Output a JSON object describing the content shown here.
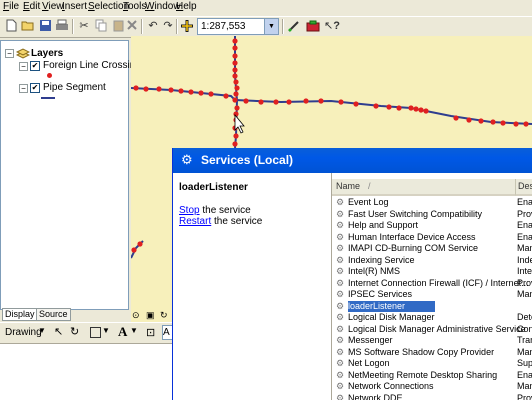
{
  "menu": [
    "File",
    "Edit",
    "View",
    "Insert",
    "Selection",
    "Tools",
    "Window",
    "Help"
  ],
  "toolbar": {
    "scale": "1:287,553",
    "help_icon": "?"
  },
  "toc": {
    "root": "Layers",
    "layer1": "Foreign Line Crossing",
    "layer2": "Pipe Segment",
    "check": "✔"
  },
  "tabs": {
    "display": "Display",
    "source": "Source"
  },
  "drawing": {
    "label": "Drawing",
    "text_tool": "A",
    "font_box": "A"
  },
  "colors": {
    "pipe_line": "#2f3d8f",
    "crossing_point": "#e02020",
    "map_background": "#f7f0bb",
    "selection": "#316ac5"
  },
  "services_window": {
    "title": "Services (Local)",
    "selected_service": "loaderListener",
    "stop_link": "Stop",
    "stop_suffix": " the service",
    "restart_link": "Restart",
    "restart_suffix": " the service",
    "columns": {
      "name": "Name",
      "sort_indicator": "/",
      "description": "Des"
    },
    "services": [
      {
        "name": "Event Log",
        "desc": "Ena"
      },
      {
        "name": "Fast User Switching Compatibility",
        "desc": "Prov"
      },
      {
        "name": "Help and Support",
        "desc": "Ena"
      },
      {
        "name": "Human Interface Device Access",
        "desc": "Ena"
      },
      {
        "name": "IMAPI CD-Burning COM Service",
        "desc": "Man"
      },
      {
        "name": "Indexing Service",
        "desc": "Inde"
      },
      {
        "name": "Intel(R) NMS",
        "desc": "Intel"
      },
      {
        "name": "Internet Connection Firewall (ICF) / Internet...",
        "desc": "Prov"
      },
      {
        "name": "IPSEC Services",
        "desc": "Man"
      },
      {
        "name": "loaderListener",
        "desc": ""
      },
      {
        "name": "Logical Disk Manager",
        "desc": "Dete"
      },
      {
        "name": "Logical Disk Manager Administrative Service",
        "desc": "Conf"
      },
      {
        "name": "Messenger",
        "desc": "Tran"
      },
      {
        "name": "MS Software Shadow Copy Provider",
        "desc": "Man"
      },
      {
        "name": "Net Logon",
        "desc": "Sup"
      },
      {
        "name": "NetMeeting Remote Desktop Sharing",
        "desc": "Ena"
      },
      {
        "name": "Network Connections",
        "desc": "Man"
      },
      {
        "name": "Network DDE",
        "desc": "Prov"
      }
    ]
  }
}
